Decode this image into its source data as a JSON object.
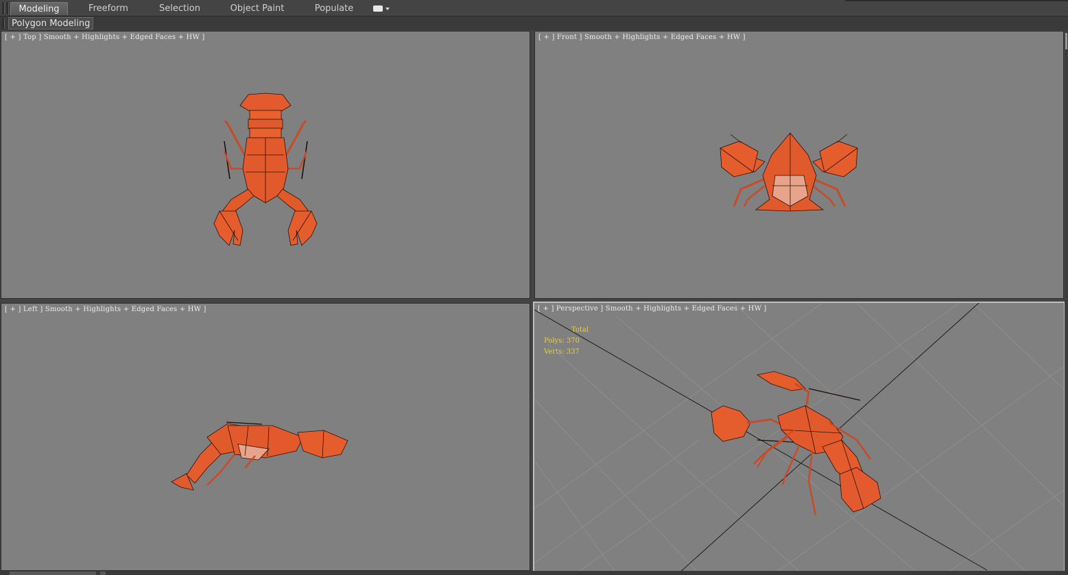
{
  "ribbon": {
    "tabs": [
      {
        "label": "Modeling",
        "active": true
      },
      {
        "label": "Freeform",
        "active": false
      },
      {
        "label": "Selection",
        "active": false
      },
      {
        "label": "Object Paint",
        "active": false
      },
      {
        "label": "Populate",
        "active": false
      }
    ],
    "more_icon": "panel-options-icon"
  },
  "subpanel": {
    "label": "Polygon Modeling"
  },
  "viewports": [
    {
      "id": "top",
      "label": "[ + ] Top ] Smooth + Highlights + Edged Faces + HW ]"
    },
    {
      "id": "front",
      "label": "[ + ] Front ] Smooth + Highlights + Edged Faces + HW ]"
    },
    {
      "id": "left",
      "label": "[ + ] Left ] Smooth + Highlights + Edged Faces + HW ]"
    },
    {
      "id": "perspective",
      "label": "[ + ] Perspective ] Smooth + Highlights + Edged Faces + HW ]"
    }
  ],
  "stats": {
    "total_label": "Total",
    "polys": "Polys: 370",
    "verts": "Verts: 337"
  },
  "colors": {
    "viewport_bg": "#808080",
    "active_border": "#bfbfbf",
    "stats_text": "#e8d23a",
    "model": "#e0542a"
  }
}
